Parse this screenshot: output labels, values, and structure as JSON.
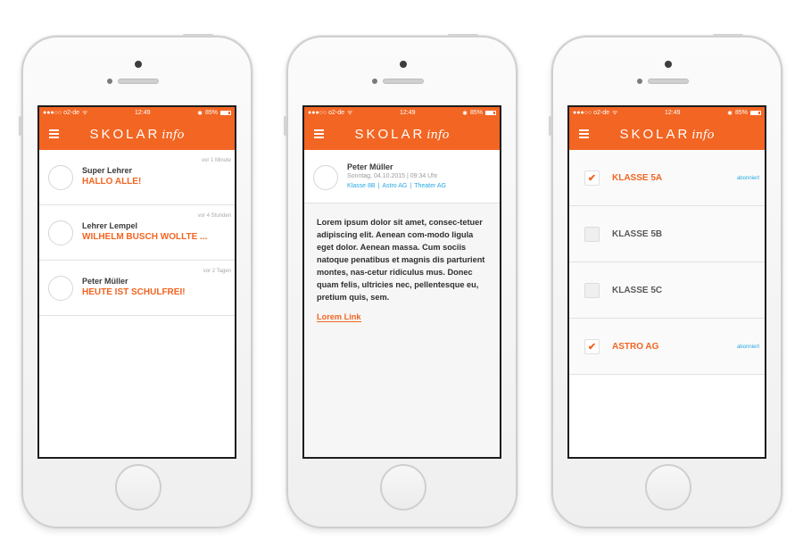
{
  "status_bar": {
    "carrier": "●●●○○ o2-de",
    "time": "12:49",
    "battery": "85%",
    "battery_level": 0.85
  },
  "app": {
    "logo_text": "SKOLAR",
    "logo_suffix": "info"
  },
  "feed": {
    "items": [
      {
        "author": "Super Lehrer",
        "title": "HALLO ALLE!",
        "time": "vor 1 Minute"
      },
      {
        "author": "Lehrer Lempel",
        "title": "WILHELM BUSCH WOLLTE ...",
        "time": "vor 4 Stunden"
      },
      {
        "author": "Peter Müller",
        "title": "HEUTE IST SCHULFREI!",
        "time": "vor 2 Tagen"
      }
    ]
  },
  "detail": {
    "author": "Peter Müller",
    "date": "Sonntag, 04.10.2015  |  09:34 Uhr",
    "tags": [
      "Klasse 8B",
      "Astro AG",
      "Theater AG"
    ],
    "body": "Lorem ipsum dolor sit amet, consec-tetuer adipiscing elit. Aenean com-modo ligula eget dolor. Aenean massa. Cum sociis natoque penatibus et magnis dis parturient montes, nas-cetur ridiculus mus. Donec quam felis, ultricies nec, pellentesque eu, pretium quis, sem.",
    "link": "Lorem Link"
  },
  "subscriptions": {
    "items": [
      {
        "label": "KLASSE 5A",
        "checked": true,
        "status": "abonniert"
      },
      {
        "label": "KLASSE 5B",
        "checked": false,
        "status": ""
      },
      {
        "label": "KLASSE 5C",
        "checked": false,
        "status": ""
      },
      {
        "label": "ASTRO AG",
        "checked": true,
        "status": "abonniert"
      }
    ]
  },
  "colors": {
    "accent": "#f26522",
    "link": "#29a8e0"
  },
  "icons": {
    "check": "✔",
    "wifi": "ᯤ",
    "bluetooth": "✱"
  }
}
